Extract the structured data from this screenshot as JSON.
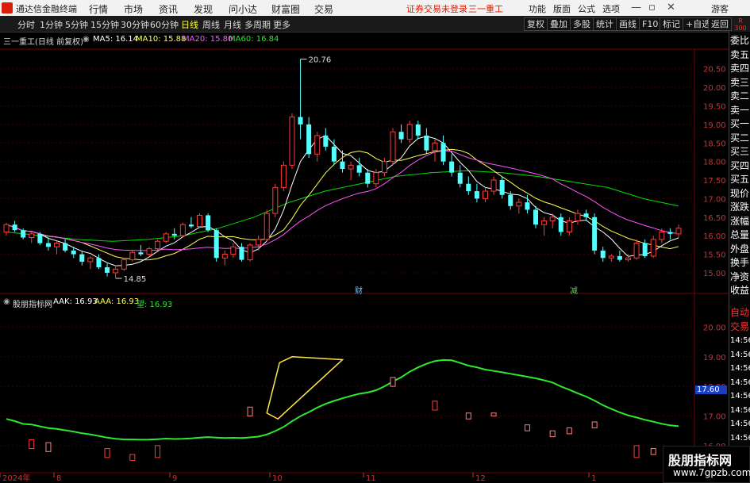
{
  "menubar": {
    "app_title": "通达信金融终端",
    "menus": [
      "行情",
      "市场",
      "资讯",
      "发现",
      "问小达",
      "财富圈",
      "交易"
    ],
    "alert": "证券交易未登录",
    "stock_name": "三一重工",
    "right_items": [
      "功能",
      "版面",
      "公式",
      "选项"
    ],
    "guest": "游客"
  },
  "periodbar": {
    "periods": [
      "分时",
      "1分钟",
      "5分钟",
      "15分钟",
      "30分钟",
      "60分钟",
      "日线",
      "周线",
      "月线",
      "多周期",
      "更多"
    ],
    "active": "日线",
    "tools": [
      "复权",
      "叠加",
      "多股",
      "统计",
      "画线",
      "F10",
      "标记",
      "+自选",
      "返回"
    ]
  },
  "main_chart": {
    "title": "三一重工(日线 前复权)",
    "ma5_label": "MA5: 16.14",
    "ma10_label": "MA10: 15.88",
    "ma20_label": "MA20: 15.80",
    "ma60_label": "MA60: 16.84",
    "price_ticks": [
      "20.50",
      "20.00",
      "19.50",
      "19.00",
      "18.50",
      "18.00",
      "17.50",
      "17.00",
      "16.50",
      "16.00",
      "15.50",
      "15.00"
    ],
    "high_marker": "20.76",
    "low_marker": "14.85",
    "event_1": "财",
    "event_2": "减",
    "colors": {
      "up": "#ff3b3b",
      "down": "#54ffff",
      "ma5": "#ffffff",
      "ma10": "#ffff54",
      "ma20": "#ff54ff",
      "ma60": "#00e000"
    }
  },
  "sub_chart": {
    "title": "股朋指标网",
    "aak_label": "AAK: 16.93",
    "aaa_label": "AAA: 16.93",
    "wang_label": "望: 16.93",
    "ticks": [
      "20.00",
      "19.00",
      "18.00",
      "17.00",
      "16.00"
    ],
    "current_value": "17.60"
  },
  "xaxis": {
    "labels": [
      "2024年",
      "8",
      "9",
      "10",
      "11",
      "12",
      "1"
    ]
  },
  "rightcol": {
    "header": "R",
    "sub": "300",
    "items": [
      "委比",
      "卖五",
      "卖四",
      "卖三",
      "卖二",
      "卖一",
      "买一",
      "买二",
      "买三",
      "买四",
      "买五",
      "现价",
      "涨跌",
      "涨幅",
      "总量",
      "外盘",
      "换手",
      "净资",
      "收益"
    ],
    "items2": [
      "自动",
      "交易",
      "14:56",
      "14:56",
      "14:56",
      "14:56",
      "14:56",
      "14:56",
      "14:56",
      "14:56",
      "14:56"
    ]
  },
  "watermark": {
    "line1": "股朋指标网",
    "line2": "www.7gpzb.com"
  },
  "chart_data": {
    "type": "candlestick",
    "ohlc": [
      [
        16.1,
        16.35,
        16.0,
        16.3
      ],
      [
        16.3,
        16.4,
        16.1,
        16.15
      ],
      [
        16.15,
        16.2,
        15.9,
        15.95
      ],
      [
        15.95,
        16.1,
        15.8,
        16.05
      ],
      [
        16.05,
        16.1,
        15.75,
        15.8
      ],
      [
        15.8,
        15.95,
        15.6,
        15.7
      ],
      [
        15.7,
        15.85,
        15.5,
        15.8
      ],
      [
        15.8,
        15.9,
        15.55,
        15.6
      ],
      [
        15.6,
        15.7,
        15.4,
        15.5
      ],
      [
        15.5,
        15.6,
        15.2,
        15.3
      ],
      [
        15.3,
        15.45,
        15.1,
        15.4
      ],
      [
        15.4,
        15.5,
        15.1,
        15.15
      ],
      [
        15.15,
        15.25,
        14.9,
        15.0
      ],
      [
        15.0,
        15.2,
        14.85,
        15.1
      ],
      [
        15.1,
        15.4,
        15.05,
        15.35
      ],
      [
        15.35,
        15.6,
        15.3,
        15.55
      ],
      [
        15.55,
        15.75,
        15.45,
        15.5
      ],
      [
        15.5,
        15.7,
        15.4,
        15.65
      ],
      [
        15.65,
        15.9,
        15.6,
        15.85
      ],
      [
        15.85,
        16.1,
        15.8,
        16.05
      ],
      [
        16.05,
        16.2,
        15.9,
        16.0
      ],
      [
        16.0,
        16.35,
        15.95,
        16.3
      ],
      [
        16.3,
        16.5,
        16.2,
        16.25
      ],
      [
        16.25,
        16.6,
        16.2,
        16.55
      ],
      [
        16.55,
        16.6,
        16.1,
        16.15
      ],
      [
        16.15,
        16.2,
        15.3,
        15.4
      ],
      [
        15.4,
        15.6,
        15.2,
        15.5
      ],
      [
        15.5,
        15.8,
        15.4,
        15.7
      ],
      [
        15.7,
        15.8,
        15.3,
        15.35
      ],
      [
        15.35,
        15.8,
        15.3,
        15.75
      ],
      [
        15.75,
        16.0,
        15.6,
        15.9
      ],
      [
        15.9,
        16.7,
        15.85,
        16.6
      ],
      [
        16.6,
        17.4,
        16.5,
        17.3
      ],
      [
        17.3,
        18.0,
        17.2,
        17.9
      ],
      [
        17.9,
        19.3,
        17.8,
        19.2
      ],
      [
        19.2,
        20.76,
        18.6,
        19.0
      ],
      [
        19.0,
        19.2,
        18.1,
        18.2
      ],
      [
        18.2,
        18.8,
        18.0,
        18.7
      ],
      [
        18.7,
        18.9,
        18.3,
        18.4
      ],
      [
        18.4,
        18.6,
        17.9,
        18.0
      ],
      [
        18.0,
        18.3,
        17.7,
        17.8
      ],
      [
        17.8,
        18.0,
        17.5,
        17.9
      ],
      [
        17.9,
        18.1,
        17.6,
        17.7
      ],
      [
        17.7,
        17.8,
        17.3,
        17.4
      ],
      [
        17.4,
        17.8,
        17.3,
        17.7
      ],
      [
        17.7,
        18.1,
        17.6,
        18.0
      ],
      [
        18.0,
        18.9,
        17.9,
        18.8
      ],
      [
        18.8,
        19.0,
        18.5,
        18.6
      ],
      [
        18.6,
        19.1,
        18.5,
        19.0
      ],
      [
        19.0,
        19.1,
        18.6,
        18.7
      ],
      [
        18.7,
        18.9,
        18.2,
        18.3
      ],
      [
        18.3,
        18.6,
        18.0,
        18.5
      ],
      [
        18.5,
        18.7,
        17.9,
        18.0
      ],
      [
        18.0,
        18.2,
        17.6,
        17.7
      ],
      [
        17.7,
        17.9,
        17.3,
        17.4
      ],
      [
        17.4,
        17.6,
        17.1,
        17.2
      ],
      [
        17.2,
        17.4,
        16.9,
        17.0
      ],
      [
        17.0,
        17.3,
        16.9,
        17.2
      ],
      [
        17.2,
        17.6,
        17.1,
        17.5
      ],
      [
        17.5,
        17.6,
        17.0,
        17.1
      ],
      [
        17.1,
        17.2,
        16.7,
        16.8
      ],
      [
        16.8,
        17.0,
        16.6,
        16.9
      ],
      [
        16.9,
        17.1,
        16.6,
        16.7
      ],
      [
        16.7,
        16.8,
        16.2,
        16.3
      ],
      [
        16.3,
        16.5,
        16.0,
        16.4
      ],
      [
        16.4,
        16.6,
        16.2,
        16.5
      ],
      [
        16.5,
        16.6,
        16.0,
        16.1
      ],
      [
        16.1,
        16.5,
        16.0,
        16.4
      ],
      [
        16.4,
        16.7,
        16.3,
        16.6
      ],
      [
        16.6,
        16.7,
        16.4,
        16.5
      ],
      [
        16.5,
        16.6,
        15.5,
        15.6
      ],
      [
        15.6,
        15.7,
        15.3,
        15.4
      ],
      [
        15.4,
        15.5,
        15.3,
        15.45
      ],
      [
        15.45,
        15.6,
        15.3,
        15.35
      ],
      [
        15.35,
        15.5,
        15.3,
        15.4
      ],
      [
        15.4,
        15.9,
        15.35,
        15.8
      ],
      [
        15.8,
        15.9,
        15.4,
        15.45
      ],
      [
        15.45,
        16.0,
        15.4,
        15.9
      ],
      [
        15.9,
        16.2,
        15.8,
        16.1
      ],
      [
        16.1,
        16.2,
        15.9,
        16.05
      ],
      [
        16.05,
        16.3,
        15.95,
        16.2
      ]
    ],
    "ma60_points": [
      16.1,
      16.0,
      15.9,
      15.85,
      15.9,
      16.0,
      16.2,
      16.5,
      16.9,
      17.2,
      17.4,
      17.6,
      17.7,
      17.75,
      17.7,
      17.6,
      17.45,
      17.3,
      17.0,
      16.8
    ],
    "ylim": [
      14.7,
      20.9
    ]
  }
}
